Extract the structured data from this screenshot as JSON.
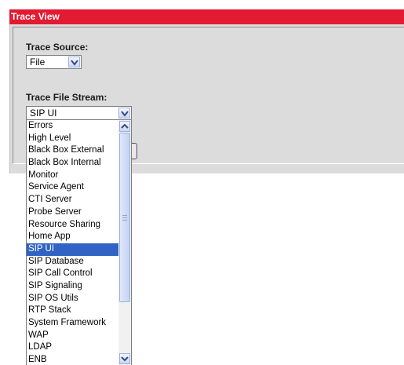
{
  "panel": {
    "title": "Trace View",
    "accent_color": "#e21a32"
  },
  "trace_source": {
    "label": "Trace Source:",
    "value": "File"
  },
  "trace_file_stream": {
    "label": "Trace File Stream:",
    "value": "SIP UI",
    "options": [
      "Errors",
      "High Level",
      "Black Box External",
      "Black Box Internal",
      "Monitor",
      "Service Agent",
      "CTI Server",
      "Probe Server",
      "Resource Sharing",
      "Home App",
      "SIP UI",
      "SIP Database",
      "SIP Call Control",
      "SIP Signaling",
      "SIP OS Utils",
      "RTP Stack",
      "System Framework",
      "WAP",
      "LDAP",
      "ENB"
    ],
    "selected_index": 10,
    "selection_color": "#3163c5"
  }
}
